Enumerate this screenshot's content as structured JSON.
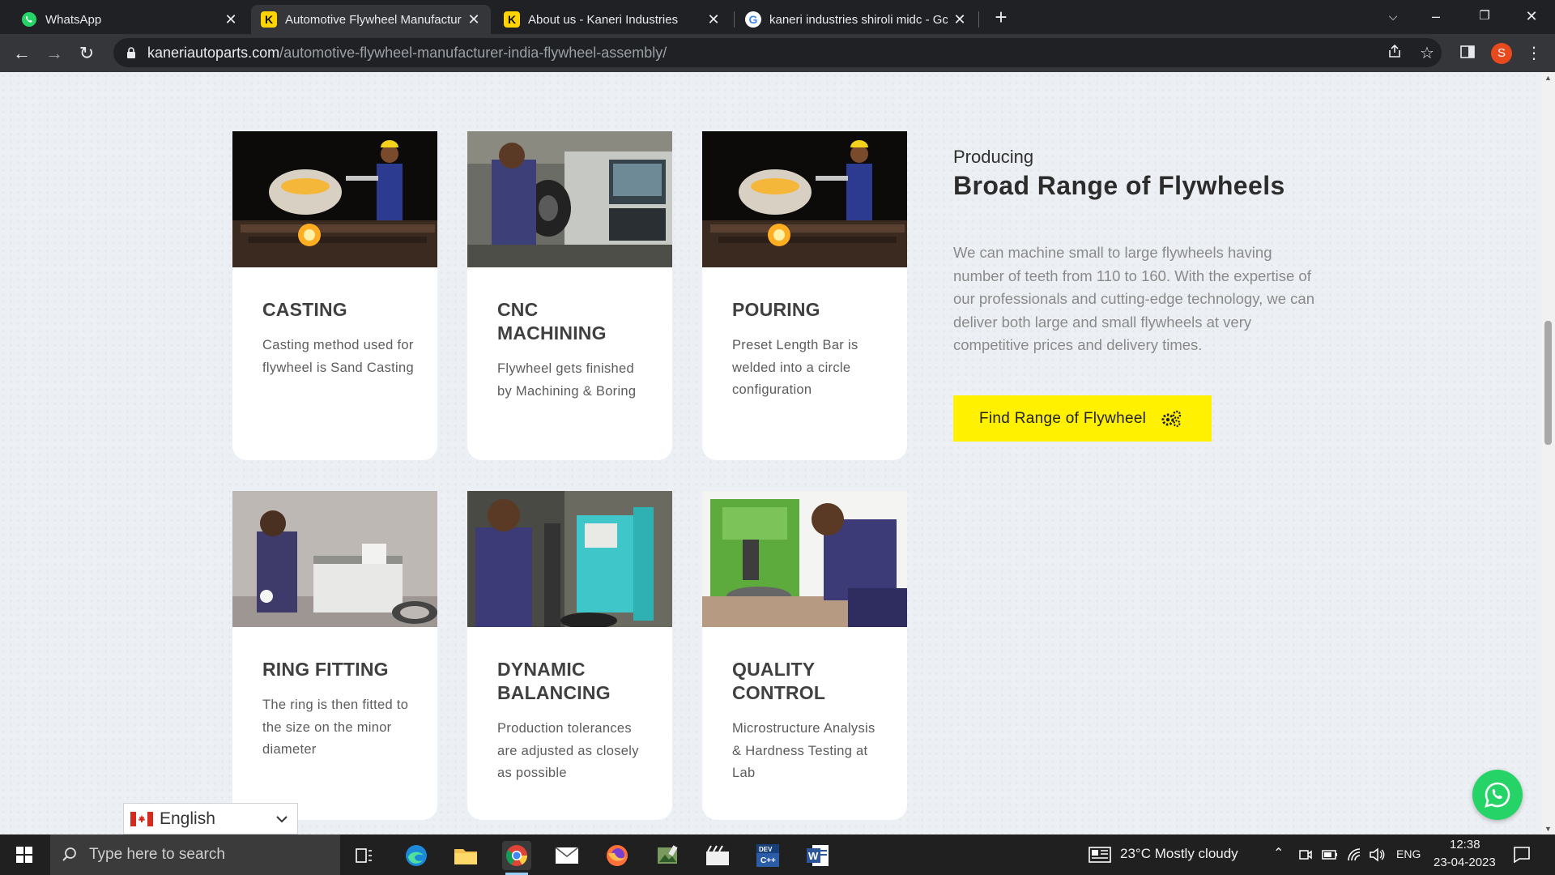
{
  "browser": {
    "tabs": [
      {
        "title": "WhatsApp",
        "favicon": "whatsapp-icon",
        "active": false
      },
      {
        "title": "Automotive Flywheel Manufactur",
        "favicon": "kaneri-k-icon",
        "active": true
      },
      {
        "title": "About us - Kaneri Industries",
        "favicon": "kaneri-k-icon",
        "active": false
      },
      {
        "title": "kaneri industries shiroli midc - Gc",
        "favicon": "google-g-icon",
        "active": false
      }
    ],
    "url_host": "kaneriautoparts.com",
    "url_path": "/automotive-flywheel-manufacturer-india-flywheel-assembly/",
    "profile_initial": "S"
  },
  "intro": {
    "kicker": "Producing",
    "title": "Broad Range of Flywheels",
    "body": "We can machine small to large flywheels having number of teeth from 110 to 160. With the expertise of our professionals and cutting-edge technology, we can deliver both large and small flywheels at very competitive prices and delivery times.",
    "button_label": "Find Range of Flywheel"
  },
  "cards": [
    {
      "title": "CASTING",
      "text": "Casting method used for flywheel is Sand Casting"
    },
    {
      "title": "CNC MACHINING",
      "text": "Flywheel gets finished by Machining & Boring"
    },
    {
      "title": "POURING",
      "text": "Preset Length Bar is welded into a circle configuration"
    },
    {
      "title": "RING FITTING",
      "text": "The ring is then fitted to the size on the minor diameter"
    },
    {
      "title": "DYNAMIC BALANCING",
      "text": "Production tolerances are adjusted as closely as possible"
    },
    {
      "title": "QUALITY CONTROL",
      "text": "Microstructure Analysis & Hardness Testing at Lab"
    }
  ],
  "language_selector": {
    "label": "English",
    "flag": "canada-flag-icon"
  },
  "taskbar": {
    "search_placeholder": "Type here to search",
    "weather": "23°C  Mostly cloudy",
    "language": "ENG",
    "time": "12:38",
    "date": "23-04-2023"
  },
  "colors": {
    "accent_yellow": "#fff100",
    "whatsapp_green": "#25d366",
    "page_bg": "#eceff3",
    "kaneri_yellow": "#ffd400"
  }
}
